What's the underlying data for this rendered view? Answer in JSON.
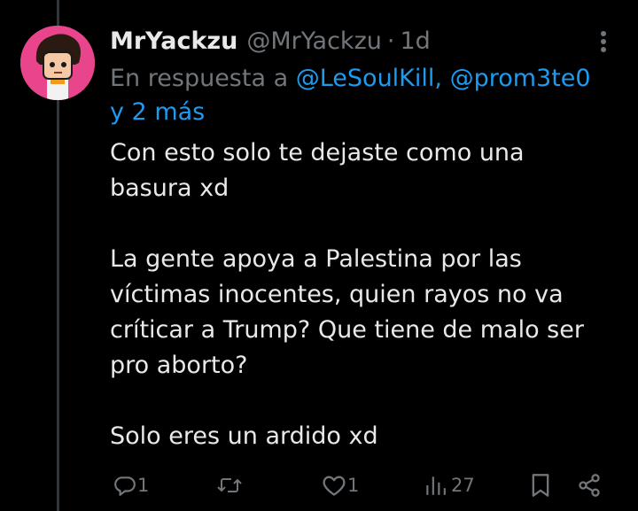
{
  "tweet": {
    "author": {
      "display_name": "MrYackzu",
      "handle": "@MrYackzu",
      "avatar_icon": "cartoon-avatar",
      "avatar_bg": "#e8458c"
    },
    "separator": "·",
    "time": "1d",
    "reply_context": {
      "prefix": "En respuesta a",
      "mentions": [
        "@LeSoulKill,",
        "@prom3te0"
      ],
      "suffix": "y 2 más"
    },
    "paragraphs": [
      [
        "Con esto solo te dejaste como una",
        "basura xd"
      ],
      [
        "La gente apoya a Palestina por las",
        "víctimas inocentes, quien rayos no va",
        "críticar a Trump? Que tiene de malo ser",
        "pro aborto?"
      ],
      [
        "Solo eres un ardido xd"
      ]
    ],
    "actions": {
      "reply": {
        "icon": "reply-icon",
        "count": "1"
      },
      "retweet": {
        "icon": "retweet-icon",
        "count": ""
      },
      "like": {
        "icon": "heart-icon",
        "count": "1"
      },
      "views": {
        "icon": "views-icon",
        "count": "27"
      },
      "bookmark": {
        "icon": "bookmark-icon"
      },
      "share": {
        "icon": "share-icon"
      }
    }
  },
  "colors": {
    "background": "#000000",
    "text": "#e7e9ea",
    "muted": "#71767b",
    "link": "#1d9bf0",
    "thread_line": "#333639"
  }
}
